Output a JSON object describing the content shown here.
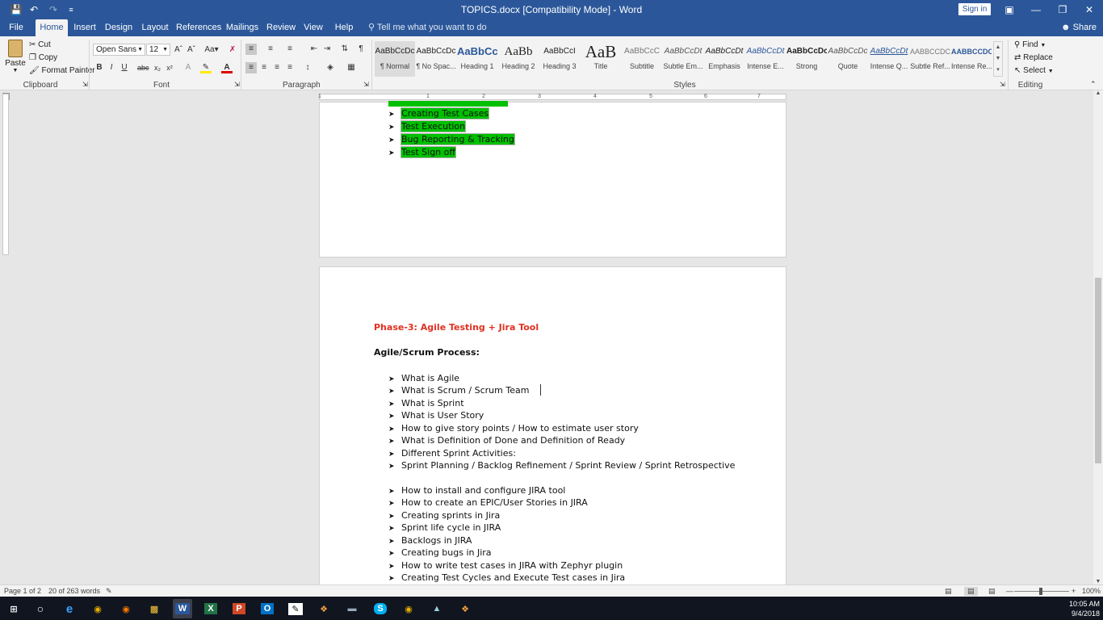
{
  "title": "TOPICS.docx [Compatibility Mode]  -  Word",
  "signin": "Sign in",
  "colors": {
    "accent": "#2b579a",
    "highlight": "#00c000",
    "heading_red": "#e03020"
  },
  "tabs": [
    "File",
    "Home",
    "Insert",
    "Design",
    "Layout",
    "References",
    "Mailings",
    "Review",
    "View",
    "Help"
  ],
  "tellme": "Tell me what you want to do",
  "share": "Share",
  "clipboard": {
    "paste": "Paste",
    "cut": "Cut",
    "copy": "Copy",
    "format_painter": "Format Painter",
    "label": "Clipboard"
  },
  "font": {
    "name": "Open Sans",
    "size": "12",
    "label": "Font"
  },
  "paragraph": {
    "label": "Paragraph"
  },
  "styles": {
    "label": "Styles",
    "items": [
      {
        "preview": "AaBbCcDc",
        "name": "¶ Normal"
      },
      {
        "preview": "AaBbCcDc",
        "name": "¶ No Spac..."
      },
      {
        "preview": "AaBbCc",
        "name": "Heading 1"
      },
      {
        "preview": "AaBb",
        "name": "Heading 2"
      },
      {
        "preview": "AaBbCcI",
        "name": "Heading 3"
      },
      {
        "preview": "AaB",
        "name": "Title"
      },
      {
        "preview": "AaBbCcC",
        "name": "Subtitle"
      },
      {
        "preview": "AaBbCcDt",
        "name": "Subtle Em..."
      },
      {
        "preview": "AaBbCcDt",
        "name": "Emphasis"
      },
      {
        "preview": "AaBbCcDt",
        "name": "Intense E..."
      },
      {
        "preview": "AaBbCcDc",
        "name": "Strong"
      },
      {
        "preview": "AaBbCcDc",
        "name": "Quote"
      },
      {
        "preview": "AaBbCcDt",
        "name": "Intense Q..."
      },
      {
        "preview": "AABBCCDC",
        "name": "Subtle Ref..."
      },
      {
        "preview": "AABBCCDC",
        "name": "Intense Re..."
      }
    ]
  },
  "editing": {
    "find": "Find",
    "replace": "Replace",
    "select": "Select",
    "label": "Editing"
  },
  "ruler": {
    "ticks": [
      "1",
      "1",
      "2",
      "3",
      "4",
      "5",
      "6",
      "7"
    ]
  },
  "page1": {
    "items": [
      "Creating Test Cases",
      "Test Execution",
      "Bug Reporting & Tracking",
      "Test Sign off"
    ]
  },
  "page2": {
    "heading": "Phase-3:  Agile Testing + Jira Tool",
    "subheading": "Agile/Scrum Process:",
    "items1": [
      "What is Agile",
      "What is Scrum / Scrum Team",
      "What is Sprint",
      "What is User Story",
      "How to give story points / How to estimate user story",
      "What is Definition of Done and Definition of Ready",
      "Different Sprint Activities:",
      "Sprint Planning / Backlog Refinement / Sprint Review / Sprint Retrospective"
    ],
    "items2": [
      "How to install and configure JIRA tool",
      "How to create an EPIC/User Stories in JIRA",
      "Creating sprints in Jira",
      "Sprint life cycle in JIRA",
      "Backlogs in JIRA",
      "Creating bugs in Jira",
      "How to write test cases in JIRA with Zephyr plugin",
      "Creating Test Cycles and Execute Test cases in Jira"
    ]
  },
  "status": {
    "page": "Page 1 of 2",
    "words": "20 of 263 words",
    "zoom": "100%"
  },
  "clock": {
    "time": "10:05 AM",
    "date": "9/4/2018"
  }
}
